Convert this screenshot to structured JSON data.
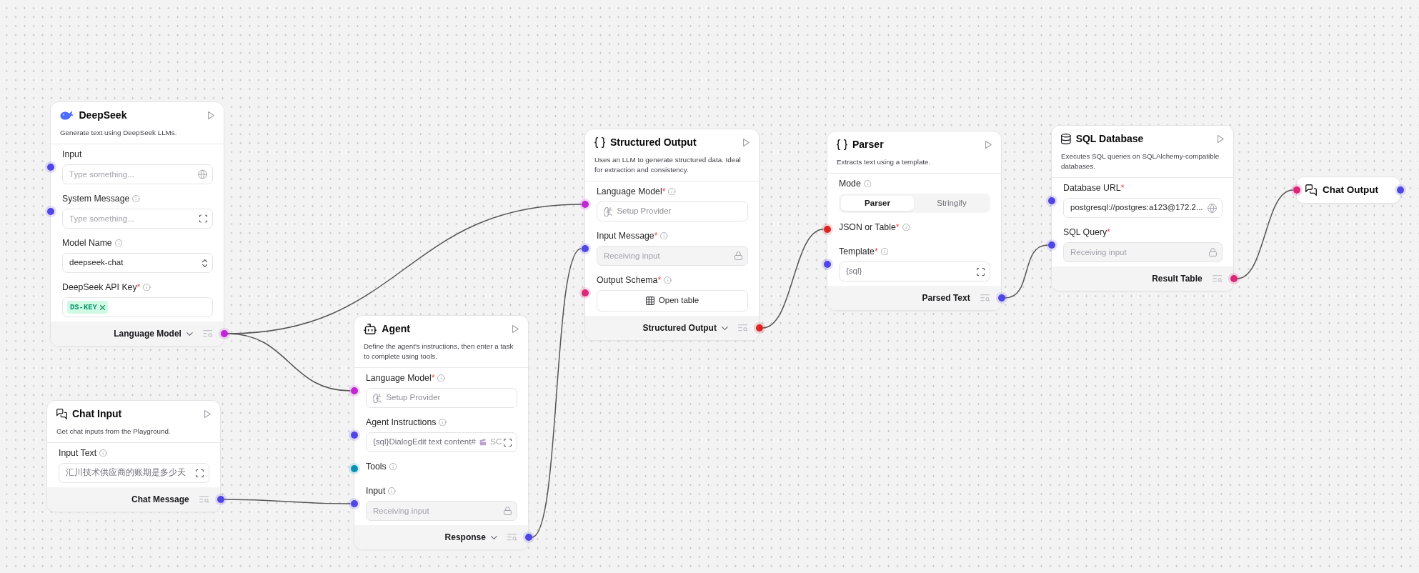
{
  "nodes": [
    {
      "kind": "llm",
      "title": "DeepSeek",
      "description": "Generate text using DeepSeek LLMs.",
      "fields": [
        {
          "kind": "text",
          "label": "Input",
          "info": false,
          "handle": {
            "color": "#4f46e5"
          },
          "placeholder": "Type something..."
        },
        {
          "kind": "textarea",
          "label": "System Message",
          "info": true,
          "handle": {
            "color": "#4f46e5"
          },
          "placeholder": "Type something..."
        },
        {
          "kind": "select",
          "label": "Model Name",
          "info": true,
          "value": "deepseek-chat"
        },
        {
          "kind": "tags",
          "label": "DeepSeek API Key",
          "required_mark": "*",
          "info": true,
          "tags": [
            "DS-KEY"
          ]
        }
      ],
      "output": {
        "label": "Language Model",
        "dropdown": true,
        "handle": {
          "color": "#c026d3"
        }
      }
    },
    {
      "kind": "chat_input",
      "title": "Chat Input",
      "description": "Get chat inputs from the Playground.",
      "fields": [
        {
          "kind": "textarea",
          "label": "Input Text",
          "info": true,
          "value": "汇川技术供应商的账期是多少天"
        }
      ],
      "output": {
        "label": "Chat Message",
        "dropdown": false,
        "handle": {
          "color": "#4f46e5"
        }
      }
    },
    {
      "kind": "agent",
      "title": "Agent",
      "description": "Define the agent's instructions, then enter a task to complete using tools.",
      "fields": [
        {
          "kind": "provider",
          "label": "Language Model",
          "required_mark": "*",
          "info": true,
          "handle": {
            "color": "#c026d3"
          },
          "button_label": "Setup Provider"
        },
        {
          "kind": "textarea",
          "label": "Agent Instructions",
          "info": true,
          "handle": {
            "color": "#4f46e5"
          },
          "value_parts": [
            {
              "kind": "text",
              "text": "{sql}DialogEdit text content#"
            },
            {
              "kind": "emoji"
            },
            {
              "kind": "faded",
              "text": "SC"
            }
          ]
        },
        {
          "kind": "handle_only",
          "label": "Tools",
          "info": true,
          "handle": {
            "color": "#0891b2"
          }
        },
        {
          "kind": "locked",
          "label": "Input",
          "info": true,
          "handle": {
            "color": "#4f46e5"
          },
          "placeholder": "Receiving input"
        }
      ],
      "output": {
        "label": "Response",
        "dropdown": true,
        "handle": {
          "color": "#4f46e5"
        }
      }
    },
    {
      "kind": "structured",
      "title": "Structured Output",
      "description": "Uses an LLM to generate structured data. Ideal for extraction and consistency.",
      "fields": [
        {
          "kind": "provider",
          "label": "Language Model",
          "required_mark": "*",
          "info": true,
          "handle": {
            "color": "#c026d3"
          },
          "button_label": "Setup Provider"
        },
        {
          "kind": "locked",
          "label": "Input Message",
          "required_mark": "*",
          "info": true,
          "handle": {
            "color": "#4f46e5"
          },
          "placeholder": "Receiving input"
        },
        {
          "kind": "table_button",
          "label": "Output Schema",
          "required_mark": "*",
          "info": true,
          "handle": {
            "color": "#db2777"
          },
          "button_label": "Open table"
        }
      ],
      "output": {
        "label": "Structured Output",
        "dropdown": true,
        "handle": {
          "color": "#dc2626"
        }
      }
    },
    {
      "kind": "parser",
      "title": "Parser",
      "description": "Extracts text using a template.",
      "fields": [
        {
          "kind": "segmented",
          "label": "Mode",
          "info": true,
          "options": [
            {
              "label": "Parser",
              "selected": true
            },
            {
              "label": "Stringify",
              "selected": false
            }
          ]
        },
        {
          "kind": "handle_only",
          "label": "JSON or Table",
          "required_mark": "*",
          "info": true,
          "handle": {
            "color": "#dc2626"
          }
        },
        {
          "kind": "textarea",
          "label": "Template",
          "required_mark": "*",
          "info": true,
          "handle": {
            "color": "#4f46e5"
          },
          "value": "{sql}"
        }
      ],
      "output": {
        "label": "Parsed Text",
        "dropdown": false,
        "handle": {
          "color": "#4f46e5"
        }
      }
    },
    {
      "kind": "database",
      "title": "SQL Database",
      "description": "Executes SQL queries on SQLAlchemy-compatible databases.",
      "fields": [
        {
          "kind": "text",
          "label": "Database URL",
          "required_mark": "*",
          "info": false,
          "handle": {
            "color": "#4f46e5"
          },
          "value": "postgresql://postgres:a123@172.2..."
        },
        {
          "kind": "locked",
          "label": "SQL Query",
          "required_mark": "*",
          "info": false,
          "handle": {
            "color": "#4f46e5"
          },
          "placeholder": "Receiving input"
        }
      ],
      "output": {
        "label": "Result Table",
        "dropdown": false,
        "handle": {
          "color": "#db2777"
        }
      }
    },
    {
      "kind": "chat_output",
      "title": "Chat Output",
      "input_handle": {
        "color": "#db2777"
      },
      "output": {
        "handle": {
          "color": "#4f46e5"
        }
      }
    }
  ]
}
